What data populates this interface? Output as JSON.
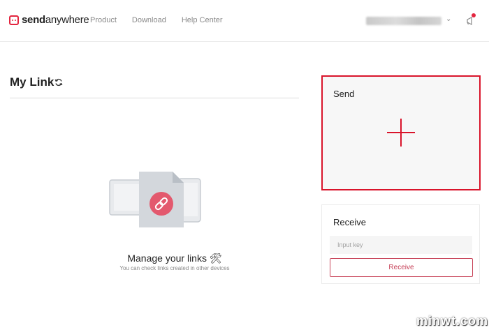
{
  "header": {
    "logo_text": "sendanywhere",
    "nav": [
      "Product",
      "Download",
      "Help Center"
    ],
    "account_email": "p••••••••@gmail.com",
    "colors": {
      "brand": "#e3253f"
    }
  },
  "mylink": {
    "title": "My Link",
    "empty_title": "Manage your links 🛠",
    "empty_subtitle": "You can check links created in other devices"
  },
  "send": {
    "label": "Send",
    "icon": "plus-icon"
  },
  "receive": {
    "label": "Receive",
    "input_placeholder": "Input key",
    "input_value": "",
    "button_label": "Receive"
  },
  "watermark": "minwt.com"
}
